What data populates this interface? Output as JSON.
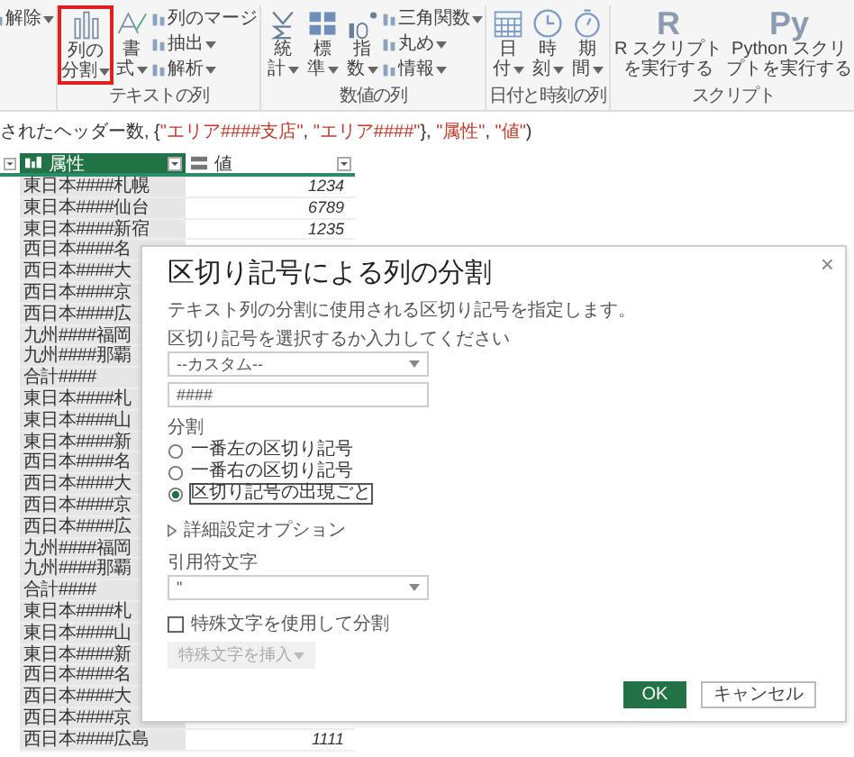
{
  "ribbon": {
    "groups": [
      {
        "items": [
          {
            "kind": "stack",
            "entries": [
              {
                "label": "解除",
                "dropdown": true
              }
            ]
          }
        ]
      },
      {
        "label": "テキストの列",
        "items": [
          {
            "kind": "large",
            "lines": [
              "列の",
              "分割"
            ],
            "dropdown": true,
            "highlighted": true
          },
          {
            "kind": "large",
            "lines": [
              "書",
              "式"
            ],
            "dropdown": true,
            "highlighted": false
          },
          {
            "kind": "stack",
            "entries": [
              {
                "label": "列のマージ",
                "dropdown": false
              },
              {
                "label": "抽出",
                "dropdown": true
              },
              {
                "label": "解析",
                "dropdown": true
              }
            ]
          }
        ]
      },
      {
        "label": "数値の列",
        "items": [
          {
            "kind": "large",
            "lines": [
              "統",
              "計"
            ],
            "dropdown": true,
            "highlighted": false
          },
          {
            "kind": "large",
            "lines": [
              "標",
              "準"
            ],
            "dropdown": true,
            "highlighted": false
          },
          {
            "kind": "large",
            "lines": [
              "指",
              "数"
            ],
            "dropdown": true,
            "highlighted": false
          },
          {
            "kind": "stack",
            "entries": [
              {
                "label": "三角関数",
                "dropdown": true
              },
              {
                "label": "丸め",
                "dropdown": true
              },
              {
                "label": "情報",
                "dropdown": true
              }
            ]
          }
        ]
      },
      {
        "label": "日付と時刻の列",
        "items": [
          {
            "kind": "large",
            "lines": [
              "日",
              "付"
            ],
            "dropdown": true,
            "highlighted": false
          },
          {
            "kind": "large",
            "lines": [
              "時",
              "刻"
            ],
            "dropdown": true,
            "highlighted": false
          },
          {
            "kind": "large",
            "lines": [
              "期",
              "間"
            ],
            "dropdown": true,
            "highlighted": false
          }
        ]
      },
      {
        "label": "スクリプト",
        "items": [
          {
            "kind": "large",
            "glyph": "R",
            "lines": [
              "R スクリプト",
              "を実行する"
            ],
            "dropdown": false,
            "highlighted": false
          },
          {
            "kind": "large",
            "glyph": "Py",
            "lines": [
              "Python スクリ",
              "プトを実行する"
            ],
            "dropdown": false,
            "highlighted": false
          }
        ]
      }
    ]
  },
  "formula": {
    "parts": [
      {
        "kind": "plain",
        "text": "されたヘッダー数, {"
      },
      {
        "kind": "string",
        "text": "\"エリア####支店\""
      },
      {
        "kind": "plain",
        "text": ", "
      },
      {
        "kind": "string",
        "text": "\"エリア####\""
      },
      {
        "kind": "plain",
        "text": "}, "
      },
      {
        "kind": "string",
        "text": "\"属性\""
      },
      {
        "kind": "plain",
        "text": ", "
      },
      {
        "kind": "string",
        "text": "\"値\""
      },
      {
        "kind": "plain",
        "text": ")"
      }
    ]
  },
  "table": {
    "columns": [
      {
        "label": "属性",
        "kind": "text",
        "selected": true
      },
      {
        "label": "値",
        "kind": "any",
        "selected": false
      }
    ],
    "rows": [
      {
        "attr": "東日本####札幌",
        "value": "1234"
      },
      {
        "attr": "東日本####仙台",
        "value": "6789"
      },
      {
        "attr": "東日本####新宿",
        "value": "1235"
      },
      {
        "attr": "西日本####名"
      },
      {
        "attr": "西日本####大"
      },
      {
        "attr": "西日本####京"
      },
      {
        "attr": "西日本####広"
      },
      {
        "attr": "九州####福岡"
      },
      {
        "attr": "九州####那覇"
      },
      {
        "attr": "合計####"
      },
      {
        "attr": "東日本####札"
      },
      {
        "attr": "東日本####山"
      },
      {
        "attr": "東日本####新"
      },
      {
        "attr": "西日本####名"
      },
      {
        "attr": "西日本####大"
      },
      {
        "attr": "西日本####京"
      },
      {
        "attr": "西日本####広"
      },
      {
        "attr": "九州####福岡"
      },
      {
        "attr": "九州####那覇"
      },
      {
        "attr": "合計####"
      },
      {
        "attr": "東日本####札"
      },
      {
        "attr": "東日本####山"
      },
      {
        "attr": "東日本####新"
      },
      {
        "attr": "西日本####名"
      },
      {
        "attr": "西日本####大"
      },
      {
        "attr": "西日本####京"
      },
      {
        "attr": "西日本####広島",
        "value": "1111"
      }
    ]
  },
  "dialog": {
    "close": "×",
    "title": "区切り記号による列の分割",
    "description": "テキスト列の分割に使用される区切り記号を指定します。",
    "delimiter_label": "区切り記号を選択するか入力してください",
    "delimiter_select": "--カスタム--",
    "delimiter_input": "####",
    "split_label": "分割",
    "split_options": [
      {
        "label": "一番左の区切り記号",
        "selected": false
      },
      {
        "label": "一番右の区切り記号",
        "selected": false
      },
      {
        "label": "区切り記号の出現ごと",
        "selected": true
      }
    ],
    "advanced": {
      "label": "詳細設定オプション",
      "expanded": false
    },
    "quote_label": "引用符文字",
    "quote_select": "\"",
    "special": {
      "label": "特殊文字を使用して分割",
      "checked": false
    },
    "insert_button": {
      "label": "特殊文字を挿入",
      "disabled": true
    },
    "ok": "OK",
    "cancel": "キャンセル"
  }
}
